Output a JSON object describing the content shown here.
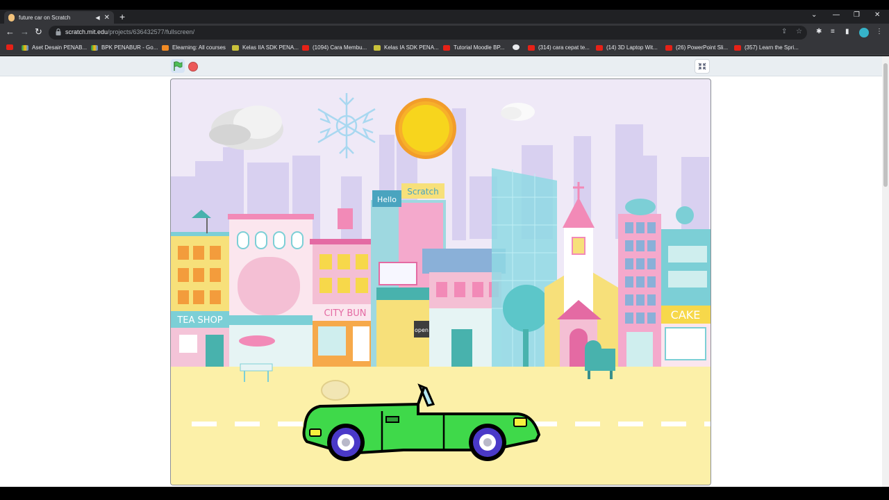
{
  "browser": {
    "tab_title": "future car on Scratch",
    "new_tab_symbol": "+",
    "url_domain": "scratch.mit.edu",
    "url_path": "/projects/636432577/fullscreen/"
  },
  "bookmarks": [
    {
      "label": "",
      "icon": "youtube-icon"
    },
    {
      "label": "Aset Desain PENAB...",
      "icon": "google-drive-icon"
    },
    {
      "label": "BPK PENABUR - Go...",
      "icon": "google-drive-icon"
    },
    {
      "label": "Elearning: All courses",
      "icon": "moodle-icon"
    },
    {
      "label": "Kelas IIA SDK PENA...",
      "icon": "classroom-icon"
    },
    {
      "label": "(1094) Cara Membu...",
      "icon": "youtube-icon"
    },
    {
      "label": "Kelas IA SDK PENA...",
      "icon": "classroom-icon"
    },
    {
      "label": "Tutorial Moodle BP...",
      "icon": "youtube-icon"
    },
    {
      "label": "",
      "icon": "globe-icon"
    },
    {
      "label": "(314) cara cepat te...",
      "icon": "youtube-icon"
    },
    {
      "label": "(14) 3D Laptop Wit...",
      "icon": "youtube-icon"
    },
    {
      "label": "(26) PowerPoint Sli...",
      "icon": "youtube-icon"
    },
    {
      "label": "(357) Learn the Spri...",
      "icon": "youtube-icon"
    }
  ],
  "stage": {
    "signs": {
      "tea_shop": "TEA SHOP",
      "city_bun": "CITY BUN",
      "cake": "CAKE",
      "hello": "Hello",
      "scratch": "Scratch",
      "open": "open"
    }
  },
  "colors": {
    "car_body": "#3fd94a",
    "sky": "#efe9f7",
    "road": "#fcf0a8",
    "sun": "#f7d51d",
    "stop_button": "#ec5959",
    "flag": "#4cbf56"
  }
}
